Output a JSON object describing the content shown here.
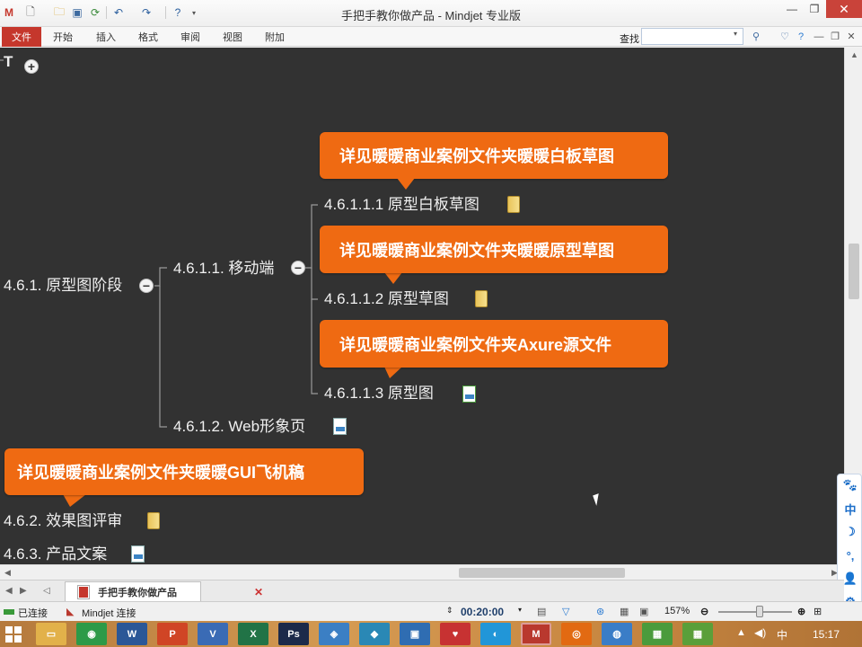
{
  "window": {
    "title": "手把手教你做产品 - Mindjet 专业版",
    "min_label": "—",
    "max_label": "❐",
    "close_label": "✕"
  },
  "ribbon": {
    "file": "文件",
    "tabs": [
      "开始",
      "插入",
      "格式",
      "审阅",
      "视图",
      "附加"
    ],
    "find_label": "查找",
    "find_value": ""
  },
  "map": {
    "root_stub": "T",
    "nodes": {
      "n461": "4.6.1. 原型图阶段",
      "n4611": "4.6.1.1. 移动端",
      "n46111": "4.6.1.1.1 原型白板草图",
      "n46112": "4.6.1.1.2 原型草图",
      "n46113": "4.6.1.1.3 原型图",
      "n4612": "4.6.1.2. Web形象页",
      "n462": "4.6.2. 效果图评审",
      "n463": "4.6.3. 产品文案"
    },
    "callouts": {
      "c1": "详见暖暖商业案例文件夹暖暖白板草图",
      "c2": "详见暖暖商业案例文件夹暖暖原型草图",
      "c3": "详见暖暖商业案例文件夹Axure源文件",
      "c4": "详见暖暖商业案例文件夹暖暖GUI飞机稿"
    },
    "colors": {
      "canvas": "#323232",
      "callout": "#ef6a12",
      "node_text": "#f0f0f0",
      "connector": "#9a9a9a"
    }
  },
  "doc_tab": {
    "label": "手把手教你做产品",
    "close": "✕"
  },
  "status": {
    "connection": "已连接",
    "mindjet": "Mindjet 连接",
    "time": "00:20:00",
    "zoom": "157%"
  },
  "ime_panel": [
    "🐾",
    "中",
    "☽",
    "°,",
    "👤",
    "⚙"
  ],
  "taskbar": {
    "ime": "中",
    "clock": "15:17",
    "apps": [
      {
        "icon": "explorer-icon",
        "glyph": "▭",
        "color": "#e2b14a"
      },
      {
        "icon": "chrome-icon",
        "glyph": "◉",
        "color": "#2d9a48"
      },
      {
        "icon": "word-icon",
        "glyph": "W",
        "color": "#2b5797"
      },
      {
        "icon": "powerpoint-icon",
        "glyph": "P",
        "color": "#d04525"
      },
      {
        "icon": "visio-icon",
        "glyph": "V",
        "color": "#3a6bb5"
      },
      {
        "icon": "excel-icon",
        "glyph": "X",
        "color": "#217346"
      },
      {
        "icon": "photoshop-icon",
        "glyph": "Ps",
        "color": "#1c2a4a"
      },
      {
        "icon": "app-blue-icon",
        "glyph": "◈",
        "color": "#3b7fc4"
      },
      {
        "icon": "app-teal-icon",
        "glyph": "◆",
        "color": "#2a88b5"
      },
      {
        "icon": "app-blue2-icon",
        "glyph": "▣",
        "color": "#2f6db2"
      },
      {
        "icon": "app-red-icon",
        "glyph": "♥",
        "color": "#c73232"
      },
      {
        "icon": "app-skype-icon",
        "glyph": "◐",
        "color": "#2196d8"
      },
      {
        "icon": "mindjet-icon",
        "glyph": "M",
        "color": "#b9382e"
      },
      {
        "icon": "app-orange-icon",
        "glyph": "◎",
        "color": "#e26a12"
      },
      {
        "icon": "app-globe-icon",
        "glyph": "◍",
        "color": "#3a7dc7"
      },
      {
        "icon": "app-green-icon",
        "glyph": "▦",
        "color": "#4a9b3c"
      },
      {
        "icon": "app-green2-icon",
        "glyph": "▦",
        "color": "#5a9f3a"
      }
    ]
  }
}
